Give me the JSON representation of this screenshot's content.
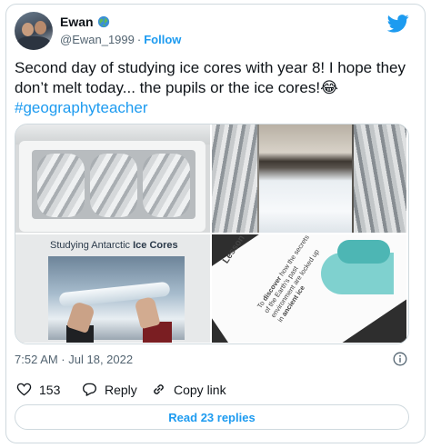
{
  "author": {
    "display_name": "Ewan",
    "handle": "@Ewan_1999",
    "separator": "·",
    "follow_label": "Follow"
  },
  "tweet": {
    "text_line1": "Second day of studying ice cores with year 8! I hope they don’t melt today... the pupils or the ice cores!",
    "emoji": "😂",
    "hashtag": "#geographyteacher"
  },
  "media": {
    "slide_left_title_prefix": "Studying Antarctic ",
    "slide_left_title_bold": "Ice Cores",
    "slide_right_title": "Lesson Purpose",
    "slide_right_body_1": "To ",
    "slide_right_body_discover": "discover",
    "slide_right_body_2": " how the secrets of the Earth's past environment are locked up in ",
    "slide_right_body_ancient": "ancient ice"
  },
  "timestamp": "7:52 AM · Jul 18, 2022",
  "actions": {
    "like_count": "153",
    "reply_label": "Reply",
    "copy_label": "Copy link"
  },
  "read_replies_label": "Read 23 replies",
  "icons": {
    "brand": "twitter-bird-icon",
    "badge": "globe-emoji-icon",
    "info": "info-icon",
    "like": "heart-icon",
    "reply": "speech-bubble-icon",
    "copy": "link-icon"
  },
  "colors": {
    "accent": "#1d9bf0",
    "text": "#0f1419",
    "secondary": "#536471",
    "border": "#cfd9de"
  }
}
